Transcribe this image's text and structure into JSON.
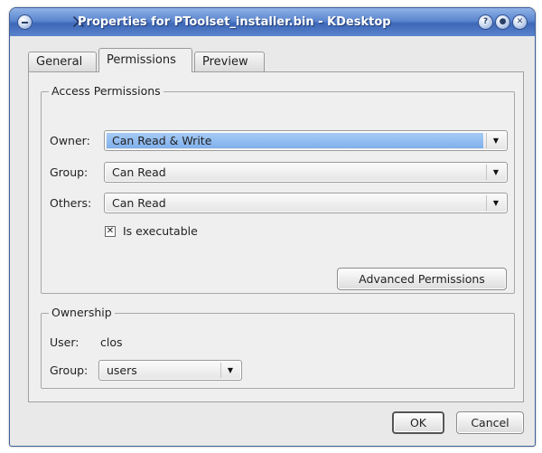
{
  "window": {
    "title": "Properties for PToolset_installer.bin - KDesktop",
    "menu_icon": "menu-circle-icon",
    "app_icon": "x-icon",
    "controls": [
      {
        "name": "help-button",
        "glyph": "?"
      },
      {
        "name": "minimize-button",
        "glyph": "●"
      },
      {
        "name": "close-button",
        "glyph": "✕"
      }
    ]
  },
  "tabs": [
    {
      "label": "General",
      "active": false
    },
    {
      "label": "Permissions",
      "active": true
    },
    {
      "label": "Preview",
      "active": false
    }
  ],
  "access_permissions": {
    "title": "Access Permissions",
    "owner": {
      "label": "Owner:",
      "value": "Can Read & Write"
    },
    "group": {
      "label": "Group:",
      "value": "Can Read"
    },
    "others": {
      "label": "Others:",
      "value": "Can Read"
    },
    "executable": {
      "label": "Is executable",
      "checked": true,
      "mark": "✕"
    },
    "advanced_button": "Advanced Permissions"
  },
  "ownership": {
    "title": "Ownership",
    "user_label": "User:",
    "user_value": "clos",
    "group_label": "Group:",
    "group_value": "users"
  },
  "footer": {
    "ok": "OK",
    "cancel": "Cancel"
  },
  "icons": {
    "combo_arrow": "▼"
  }
}
